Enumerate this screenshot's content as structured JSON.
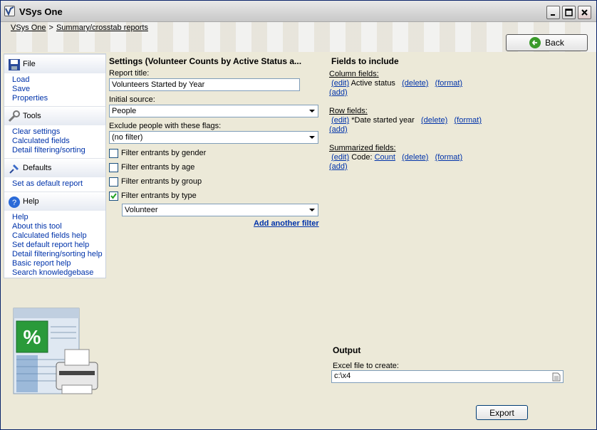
{
  "window": {
    "title": "VSys One"
  },
  "breadcrumb": {
    "root": "VSys One",
    "separator": ">",
    "current": "Summary/crosstab reports"
  },
  "back_label": "Back",
  "sidebar": {
    "file": {
      "label": "File",
      "items": [
        "Load",
        "Save",
        "Properties"
      ]
    },
    "tools": {
      "label": "Tools",
      "items": [
        "Clear settings",
        "Calculated fields",
        "Detail filtering/sorting"
      ]
    },
    "defaults": {
      "label": "Defaults",
      "items": [
        "Set as default report"
      ]
    },
    "help": {
      "label": "Help",
      "items": [
        "Help",
        "About this tool",
        "Calculated fields help",
        "Set default report help",
        "Detail filtering/sorting help",
        "Basic report help",
        "Search knowledgebase"
      ]
    }
  },
  "settings": {
    "title": "Settings (Volunteer Counts by Active Status a...",
    "report_title_label": "Report title:",
    "report_title_value": "Volunteers Started by Year",
    "initial_source_label": "Initial source:",
    "initial_source_value": "People",
    "exclude_label": "Exclude people with these flags:",
    "exclude_value": "(no filter)",
    "filters": [
      {
        "label": "Filter entrants by gender",
        "checked": false
      },
      {
        "label": "Filter entrants by age",
        "checked": false
      },
      {
        "label": "Filter entrants by group",
        "checked": false
      },
      {
        "label": "Filter entrants by type",
        "checked": true
      }
    ],
    "type_value": "Volunteer",
    "add_filter": "Add another filter"
  },
  "fields": {
    "title": "Fields to include",
    "edit": "(edit)",
    "delete": "(delete)",
    "format": "(format)",
    "add": "(add)",
    "column_label": "Column fields:",
    "column_field": "Active status",
    "row_label": "Row fields:",
    "row_field": "*Date started year",
    "summarized_label": "Summarized fields:",
    "summarized_prefix": "Code:",
    "summarized_func": "Count"
  },
  "output": {
    "title": "Output",
    "file_label": "Excel file to create:",
    "file_value": "c:\\x4",
    "export_label": "Export"
  },
  "colors": {
    "link": "#0033aa",
    "accent": "#3a9a2a"
  }
}
